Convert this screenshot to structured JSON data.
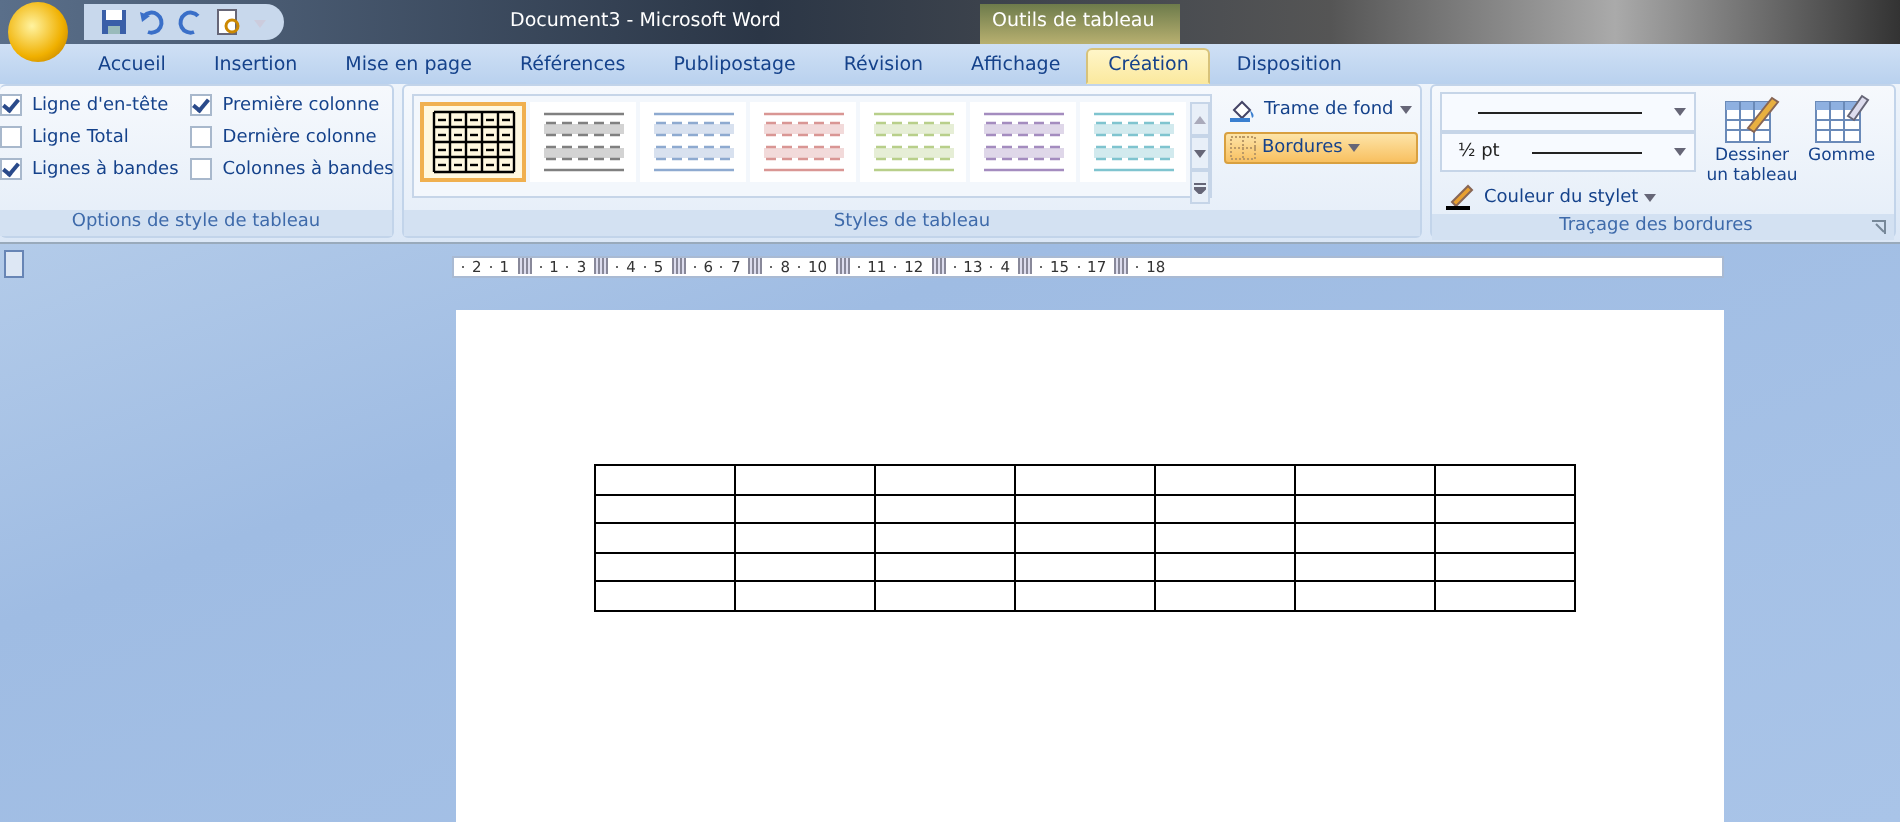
{
  "window": {
    "title": "Document3 - Microsoft Word",
    "context_title": "Outils de tableau"
  },
  "tabs": [
    {
      "label": "Accueil",
      "selected": false
    },
    {
      "label": "Insertion",
      "selected": false
    },
    {
      "label": "Mise en page",
      "selected": false
    },
    {
      "label": "Références",
      "selected": false
    },
    {
      "label": "Publipostage",
      "selected": false
    },
    {
      "label": "Révision",
      "selected": false
    },
    {
      "label": "Affichage",
      "selected": false
    },
    {
      "label": "Création",
      "selected": true
    },
    {
      "label": "Disposition",
      "selected": false
    }
  ],
  "style_options": {
    "title": "Options de style de tableau",
    "items": [
      {
        "label": "Ligne d'en-tête",
        "checked": true
      },
      {
        "label": "Ligne Total",
        "checked": false
      },
      {
        "label": "Lignes à bandes",
        "checked": true
      },
      {
        "label": "Première colonne",
        "checked": true
      },
      {
        "label": "Dernière colonne",
        "checked": false
      },
      {
        "label": "Colonnes à bandes",
        "checked": false
      }
    ]
  },
  "table_styles": {
    "title": "Styles de tableau",
    "shading": "Trame de fond",
    "borders": "Bordures",
    "styles": [
      {
        "kind": "grid",
        "color": "#000000",
        "selected": true
      },
      {
        "kind": "banded",
        "color": "#808080",
        "selected": false
      },
      {
        "kind": "banded",
        "color": "#8eaad0",
        "selected": false
      },
      {
        "kind": "banded",
        "color": "#d99694",
        "selected": false
      },
      {
        "kind": "banded",
        "color": "#b8cf8a",
        "selected": false
      },
      {
        "kind": "banded",
        "color": "#a48cbf",
        "selected": false
      },
      {
        "kind": "banded",
        "color": "#7fc4cf",
        "selected": false
      }
    ]
  },
  "border_drawing": {
    "title": "Traçage des bordures",
    "weight": "½ pt",
    "pen_color": "Couleur du stylet",
    "draw_table": "Dessiner un tableau",
    "eraser": "Gomme"
  },
  "ruler": {
    "numbers": [
      "2",
      "1",
      "1",
      "3",
      "4",
      "5",
      "6",
      "7",
      "8",
      "10",
      "11",
      "12",
      "13",
      "4",
      "15",
      "17",
      "18"
    ]
  }
}
